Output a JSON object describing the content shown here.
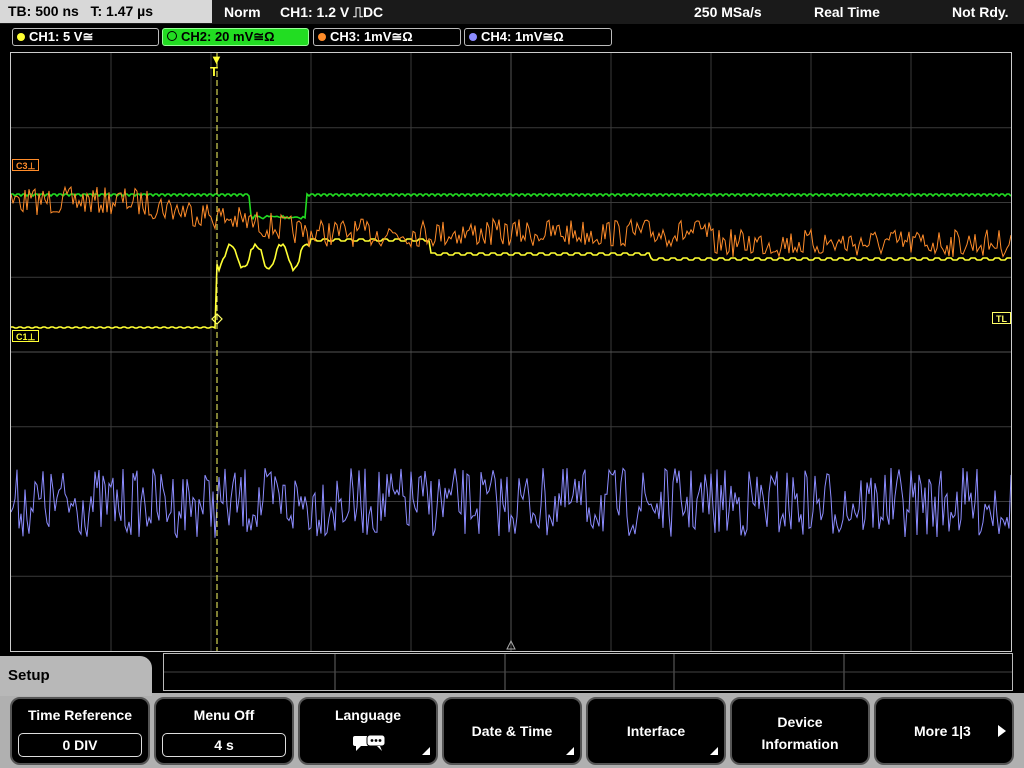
{
  "status": {
    "timebase": "TB: 500 ns",
    "trigger_time": "T: 1.47 µs",
    "mode": "Norm",
    "trigger": "CH1: 1.2 V ⎍DC",
    "sample_rate": "250 MSa/s",
    "acq_mode": "Real Time",
    "state": "Not Rdy."
  },
  "channels": [
    {
      "label": "CH1: 5 V≅",
      "color": "#ffff33"
    },
    {
      "label": "CH2: 20 mV≅Ω",
      "color": "#22dd22"
    },
    {
      "label": "CH3: 1mV≅Ω",
      "color": "#ff8c2a"
    },
    {
      "label": "CH4: 1mV≅Ω",
      "color": "#8c8cff"
    }
  ],
  "markers": {
    "c3": "C3⊥",
    "c1": "C1⊥",
    "tl": "TL",
    "trigger": "T"
  },
  "menu": {
    "title": "Setup",
    "time_reference_label": "Time Reference",
    "time_reference_value": "0 DIV",
    "menu_off_label": "Menu Off",
    "menu_off_value": "4 s",
    "language_label": "Language",
    "date_time_label": "Date & Time",
    "interface_label": "Interface",
    "device_info_label_1": "Device",
    "device_info_label_2": "Information",
    "more_label": "More 1|3"
  },
  "icons": {
    "language": "speech-bubble-icon",
    "more_arrow": "right-arrow-icon",
    "submenu": "corner-triangle-icon"
  }
}
